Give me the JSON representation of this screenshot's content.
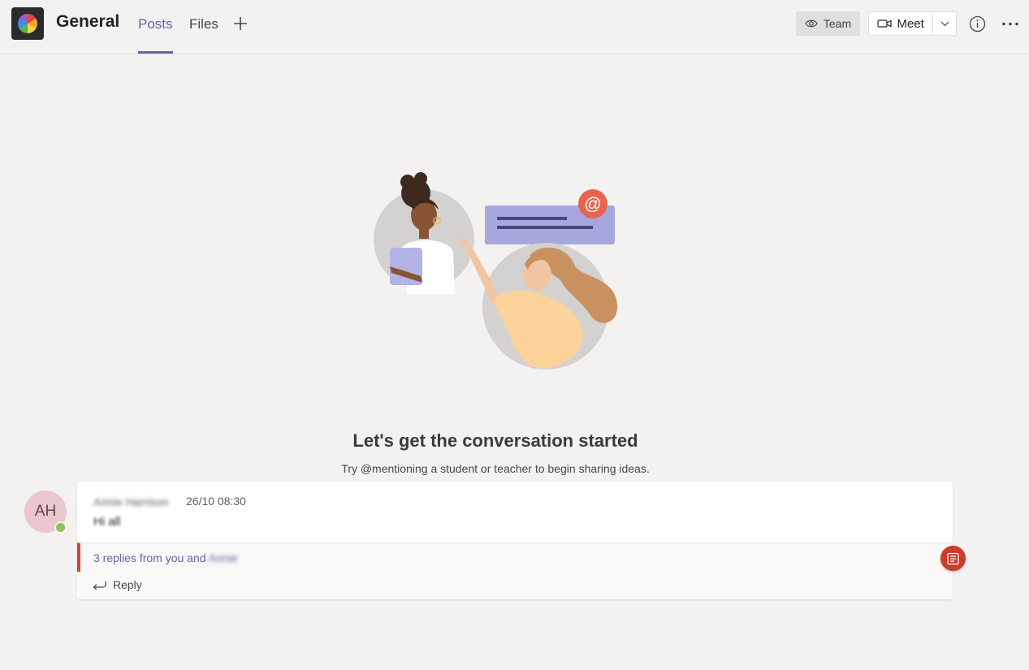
{
  "header": {
    "channel_title": "General",
    "tabs": [
      {
        "label": "Posts",
        "active": true
      },
      {
        "label": "Files",
        "active": false
      }
    ],
    "team_button": "Team",
    "meet_button": "Meet",
    "icons": [
      "team-wheel-icon",
      "plus-icon",
      "eye-icon",
      "video-camera-icon",
      "chevron-down-icon",
      "info-icon",
      "more-icon"
    ]
  },
  "empty_state": {
    "title": "Let's get the conversation started",
    "subtitle": "Try @mentioning a student or teacher to begin sharing ideas."
  },
  "post": {
    "avatar_initials": "AH",
    "author": "Annie Harrison",
    "timestamp": "26/10 08:30",
    "body": "Hi all",
    "replies_prefix": "3 replies from you and",
    "replies_name": "Annie",
    "reply_label": "Reply"
  },
  "colors": {
    "accent": "#6264a7",
    "background": "#f3f2f1",
    "thread_marker": "#cc4a31",
    "presence": "#92c353"
  }
}
